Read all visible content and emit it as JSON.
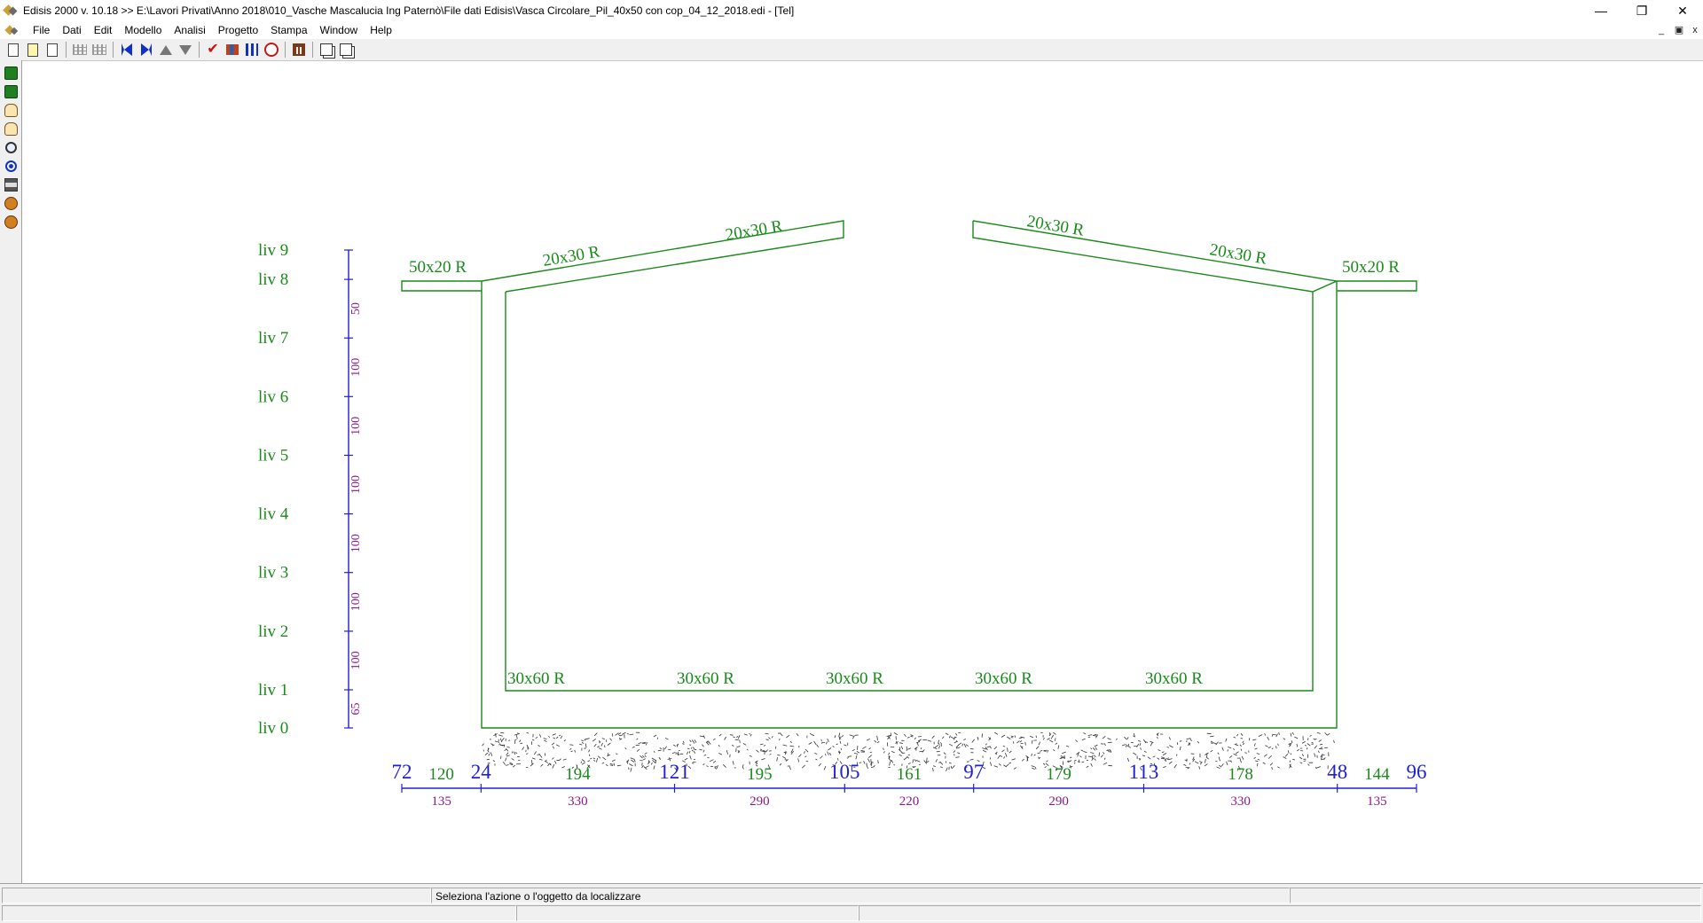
{
  "window": {
    "title": "Edisis 2000 v. 10.18 >> E:\\Lavori Privati\\Anno 2018\\010_Vasche Mascalucia Ing Paternò\\File dati Edisis\\Vasca Circolare_Pil_40x50 con cop_04_12_2018.edi - [Tel]",
    "min_glyph": "—",
    "max_glyph": "❐",
    "close_glyph": "✕",
    "mdi_min_glyph": "_",
    "mdi_restore_glyph": "▣",
    "mdi_close_glyph": "x"
  },
  "menu": [
    "File",
    "Dati",
    "Edit",
    "Modello",
    "Analisi",
    "Progetto",
    "Stampa",
    "Window",
    "Help"
  ],
  "toolbar_icons": [
    "new-file-icon",
    "open-file-icon",
    "copy-file-icon",
    "grid-icon",
    "grid-2-icon",
    "first-icon",
    "last-icon",
    "up-icon",
    "down-icon",
    "check-icon",
    "building-icon",
    "columns-icon",
    "clock-icon",
    "frame-icon",
    "copy-icon",
    "paste-icon"
  ],
  "left_toolbar_icons": [
    "select-icon",
    "select-area-icon",
    "hand-point-icon",
    "hand-pan-icon",
    "zoom-icon",
    "target-icon",
    "print-icon",
    "query-1-icon",
    "query-2-icon"
  ],
  "drawing": {
    "line_color": "#1a8a1a",
    "dim_color": "#2020d0",
    "dim_text_color": "#8a1a8a",
    "levels": [
      {
        "label": "liv 0",
        "height": 0
      },
      {
        "label": "liv 1",
        "height": 65
      },
      {
        "label": "liv 2",
        "height": 165
      },
      {
        "label": "liv 3",
        "height": 265
      },
      {
        "label": "liv 4",
        "height": 365
      },
      {
        "label": "liv 5",
        "height": 465
      },
      {
        "label": "liv 6",
        "height": 565
      },
      {
        "label": "liv 7",
        "height": 665
      },
      {
        "label": "liv 8",
        "height": 765
      },
      {
        "label": "liv 9",
        "height": 815
      }
    ],
    "level_spacings": [
      "65",
      "100",
      "100",
      "100",
      "100",
      "100",
      "100",
      "50"
    ],
    "beam_labels": {
      "base": [
        "30x60 R",
        "30x60 R",
        "30x60 R",
        "30x60 R",
        "30x60 R"
      ],
      "cantilever_left": "50x20 R",
      "cantilever_right": "50x20 R",
      "roof_left": [
        "20x30 R",
        "20x30 R"
      ],
      "roof_right": [
        "20x30 R",
        "20x30 R"
      ]
    },
    "node_numbers": [
      "72",
      "24",
      "121",
      "105",
      "97",
      "113",
      "48",
      "96"
    ],
    "span_ids": [
      "120",
      "194",
      "195",
      "161",
      "179",
      "178",
      "144"
    ],
    "span_lengths": [
      "135",
      "330",
      "290",
      "220",
      "290",
      "330",
      "135"
    ]
  },
  "status": {
    "message": "Seleziona l'azione o l'oggetto da localizzare"
  }
}
